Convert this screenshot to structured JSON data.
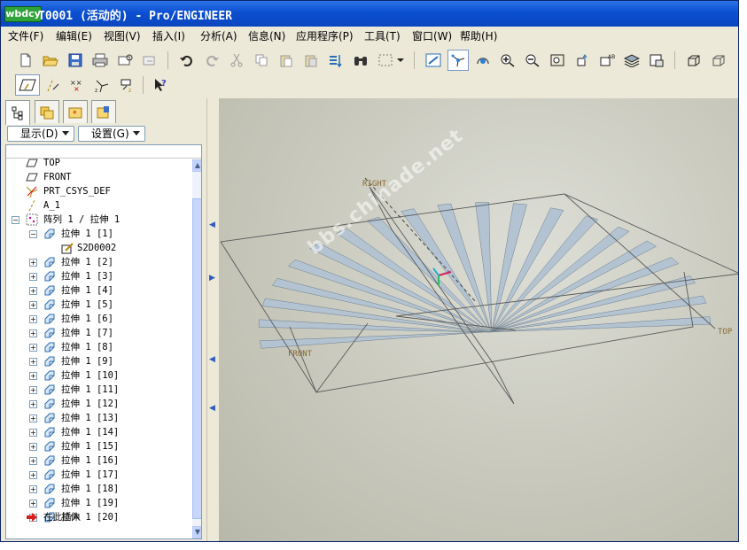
{
  "title": {
    "badge": "wbdcy",
    "text": "T0001 (活动的) - Pro/ENGINEER"
  },
  "menu": [
    {
      "label": "文件(F)"
    },
    {
      "label": "编辑(E)"
    },
    {
      "label": "视图(V)"
    },
    {
      "label": "插入(I)"
    },
    {
      "label": "分析(A)"
    },
    {
      "label": "信息(N)"
    },
    {
      "label": "应用程序(P)"
    },
    {
      "label": "工具(T)"
    },
    {
      "label": "窗口(W)"
    },
    {
      "label": "帮助(H)"
    }
  ],
  "panel": {
    "display_label": "显示(D)",
    "settings_label": "设置(G)"
  },
  "tree": {
    "items": [
      {
        "label": "TOP",
        "icon": "datum-plane-icon"
      },
      {
        "label": "FRONT",
        "icon": "datum-plane-icon"
      },
      {
        "label": "PRT_CSYS_DEF",
        "icon": "csys-icon"
      },
      {
        "label": "A_1",
        "icon": "datum-axis-icon"
      },
      {
        "label": "阵列 1 / 拉伸 1",
        "icon": "pattern-icon"
      },
      {
        "label": "拉伸 1 [1]",
        "icon": "extrude-icon"
      },
      {
        "label": "S2D0002",
        "icon": "sketch-icon"
      },
      {
        "label": "拉伸 1 [2]",
        "icon": "extrude-icon"
      },
      {
        "label": "拉伸 1 [3]",
        "icon": "extrude-icon"
      },
      {
        "label": "拉伸 1 [4]",
        "icon": "extrude-icon"
      },
      {
        "label": "拉伸 1 [5]",
        "icon": "extrude-icon"
      },
      {
        "label": "拉伸 1 [6]",
        "icon": "extrude-icon"
      },
      {
        "label": "拉伸 1 [7]",
        "icon": "extrude-icon"
      },
      {
        "label": "拉伸 1 [8]",
        "icon": "extrude-icon"
      },
      {
        "label": "拉伸 1 [9]",
        "icon": "extrude-icon"
      },
      {
        "label": "拉伸 1 [10]",
        "icon": "extrude-icon"
      },
      {
        "label": "拉伸 1 [11]",
        "icon": "extrude-icon"
      },
      {
        "label": "拉伸 1 [12]",
        "icon": "extrude-icon"
      },
      {
        "label": "拉伸 1 [13]",
        "icon": "extrude-icon"
      },
      {
        "label": "拉伸 1 [14]",
        "icon": "extrude-icon"
      },
      {
        "label": "拉伸 1 [15]",
        "icon": "extrude-icon"
      },
      {
        "label": "拉伸 1 [16]",
        "icon": "extrude-icon"
      },
      {
        "label": "拉伸 1 [17]",
        "icon": "extrude-icon"
      },
      {
        "label": "拉伸 1 [18]",
        "icon": "extrude-icon"
      },
      {
        "label": "拉伸 1 [19]",
        "icon": "extrude-icon"
      },
      {
        "label": "拉伸 1 [20]",
        "icon": "extrude-icon"
      },
      {
        "label": "在此插入",
        "icon": "insert-here-arrow-icon"
      }
    ]
  },
  "viewport": {
    "labels": {
      "right": "RIGHT",
      "top": "TOP",
      "front": "FRONT"
    },
    "watermark": "bbs.chinade.net",
    "blade_color": "#b3c3d2"
  }
}
